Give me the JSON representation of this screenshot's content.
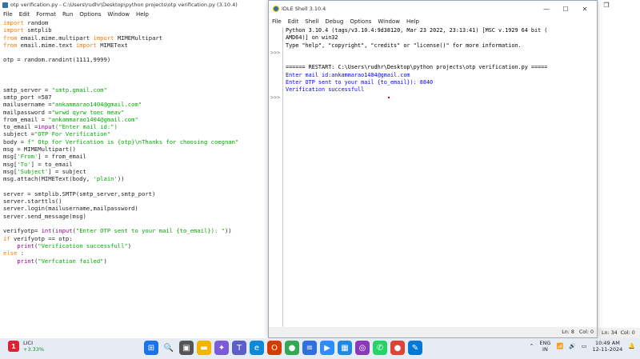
{
  "editor": {
    "title": "otp verification.py - C:\\Users\\rudhr\\Desktop\\python projects\\otp verification.py (3.10.4)",
    "menu": [
      "File",
      "Edit",
      "Format",
      "Run",
      "Options",
      "Window",
      "Help"
    ],
    "status": {
      "ln": "Ln: 34",
      "col": "Col: 0"
    },
    "code_lines": [
      [
        [
          "kw",
          "import"
        ],
        [
          "",
          "random"
        ]
      ],
      [
        [
          "kw",
          "import"
        ],
        [
          "",
          "smtplib"
        ]
      ],
      [
        [
          "kw",
          "from"
        ],
        [
          "",
          "email.mime.multipart "
        ],
        [
          "kw",
          "import"
        ],
        [
          "",
          "MIMEMultipart"
        ]
      ],
      [
        [
          "kw",
          "from"
        ],
        [
          "",
          "email.mime.text "
        ],
        [
          "kw",
          "import"
        ],
        [
          "",
          "MIMEText"
        ]
      ],
      [],
      [
        [
          "",
          "otp = random.randint(1111,9999)"
        ]
      ],
      [],
      [],
      [],
      [
        [
          "",
          "smtp_server = "
        ],
        [
          "st",
          "\"smtp.gmail.com\""
        ]
      ],
      [
        [
          "",
          "smtp_port =587"
        ]
      ],
      [
        [
          "",
          "mailusername ="
        ],
        [
          "st",
          "\"ankammarao1404@gmail.com\""
        ]
      ],
      [
        [
          "",
          "mailpassword ="
        ],
        [
          "st",
          "\"wrwd qyrw toec meav\""
        ]
      ],
      [
        [
          "",
          "from_email = "
        ],
        [
          "st",
          "\"ankammarao1404@gmail.com\""
        ]
      ],
      [
        [
          "",
          "to_email ="
        ],
        [
          "bi",
          "input"
        ],
        [
          "",
          ""
        ],
        [
          "st",
          "(\"Enter mail id:\")"
        ]
      ],
      [
        [
          "",
          "subject ="
        ],
        [
          "st",
          "\"OTP For Verification\""
        ]
      ],
      [
        [
          "",
          "body = "
        ],
        [
          "st",
          "f\" Otp for Verfication is {otp}\\nThanks for choosing coegnan\""
        ]
      ],
      [
        [
          "",
          "msg = MIMEMultipart()"
        ]
      ],
      [
        [
          "",
          "msg["
        ],
        [
          "st",
          "'From'"
        ],
        [
          "",
          "] = from_email"
        ]
      ],
      [
        [
          "",
          "msg["
        ],
        [
          "st",
          "'To'"
        ],
        [
          "",
          "] = to_email"
        ]
      ],
      [
        [
          "",
          "msg["
        ],
        [
          "st",
          "'Subject'"
        ],
        [
          "",
          "] = subject"
        ]
      ],
      [
        [
          "",
          "msg.attach(MIMEText(body, "
        ],
        [
          "st",
          "'plain'"
        ],
        [
          "",
          "))"
        ]
      ],
      [],
      [
        [
          "",
          "server = smtplib.SMTP(smtp_server,smtp_port)"
        ]
      ],
      [
        [
          "",
          "server.starttls()"
        ]
      ],
      [
        [
          "",
          "server.login(mailusername,mailpassword)"
        ]
      ],
      [
        [
          "",
          "server.send_message(msg)"
        ]
      ],
      [],
      [
        [
          "",
          "verifyotp= "
        ],
        [
          "bi",
          "int"
        ],
        [
          "",
          "("
        ],
        [
          "bi",
          "input"
        ],
        [
          "",
          "("
        ],
        [
          "st",
          "\"Enter OTP sent to your mail {to_email}): \""
        ],
        [
          "",
          "))"
        ]
      ],
      [
        [
          "kw",
          "if"
        ],
        [
          "",
          "verifyotp == otp:"
        ]
      ],
      [
        [
          "",
          "    "
        ],
        [
          "bi",
          "print"
        ],
        [
          "",
          "("
        ],
        [
          "st",
          "\"Verification successfull\""
        ],
        [
          "",
          ")"
        ]
      ],
      [
        [
          "kw",
          "else"
        ],
        [
          "",
          ":"
        ]
      ],
      [
        [
          "",
          "    "
        ],
        [
          "bi",
          "print"
        ],
        [
          "",
          "("
        ],
        [
          "st",
          "\"Verfcation failed\""
        ],
        [
          "",
          ")"
        ]
      ]
    ]
  },
  "shell": {
    "title": "IDLE Shell 3.10.4",
    "menu": [
      "File",
      "Edit",
      "Shell",
      "Debug",
      "Options",
      "Window",
      "Help"
    ],
    "prompts": [
      "",
      "",
      "",
      ">>>",
      "",
      "",
      "",
      "",
      "",
      ">>>"
    ],
    "output": [
      [
        "blk",
        "Python 3.10.4 (tags/v3.10.4:9d38120, Mar 23 2022, 23:13:41) [MSC v.1929 64 bit ("
      ],
      [
        "blk",
        "AMD64)] on win32"
      ],
      [
        "blk",
        "Type \"help\", \"copyright\", \"credits\" or \"license()\" for more information."
      ],
      [
        "blk",
        ""
      ],
      [
        "blk",
        ""
      ],
      [
        "blk",
        "====== RESTART: C:\\Users\\rudhr\\Desktop\\python projects\\otp verification.py ====="
      ],
      [
        "blu",
        "Enter mail id:ankammarao1404@gmail.com"
      ],
      [
        "blu",
        "Enter OTP sent to your mail {to_email}): 8840"
      ],
      [
        "blu",
        "Verification successfull"
      ]
    ],
    "status": {
      "ln": "Ln: 8",
      "col": "Col: 0"
    }
  },
  "taskbar": {
    "stock_name": "LICI",
    "stock_change": "+3.33%",
    "stock_badge": "1",
    "lang_top": "ENG",
    "lang_bottom": "IN",
    "time": "10:49 AM",
    "date": "12-11-2024",
    "apps": [
      {
        "name": "windows-start",
        "color": "#1a73e8",
        "glyph": "⊞"
      },
      {
        "name": "search",
        "color": "#e6ecf4",
        "glyph": "🔍"
      },
      {
        "name": "task-view",
        "color": "#555",
        "glyph": "▣"
      },
      {
        "name": "file-explorer",
        "color": "#f3b400",
        "glyph": "▬"
      },
      {
        "name": "copilot",
        "color": "#7b5cd6",
        "glyph": "✦"
      },
      {
        "name": "teams",
        "color": "#5b5fc7",
        "glyph": "T"
      },
      {
        "name": "edge",
        "color": "#0c8ad9",
        "glyph": "e"
      },
      {
        "name": "office",
        "color": "#d83b01",
        "glyph": "O"
      },
      {
        "name": "chrome",
        "color": "#34a853",
        "glyph": "●"
      },
      {
        "name": "notepad",
        "color": "#2f6fde",
        "glyph": "≡"
      },
      {
        "name": "zoom",
        "color": "#2d8cff",
        "glyph": "▶"
      },
      {
        "name": "store",
        "color": "#1e88e5",
        "glyph": "▦"
      },
      {
        "name": "idle",
        "color": "#8a3ab9",
        "glyph": "◎"
      },
      {
        "name": "whatsapp",
        "color": "#25d366",
        "glyph": "✆"
      },
      {
        "name": "chrome-profile",
        "color": "#db4437",
        "glyph": "●"
      },
      {
        "name": "paint",
        "color": "#0078d4",
        "glyph": "✎"
      }
    ]
  }
}
